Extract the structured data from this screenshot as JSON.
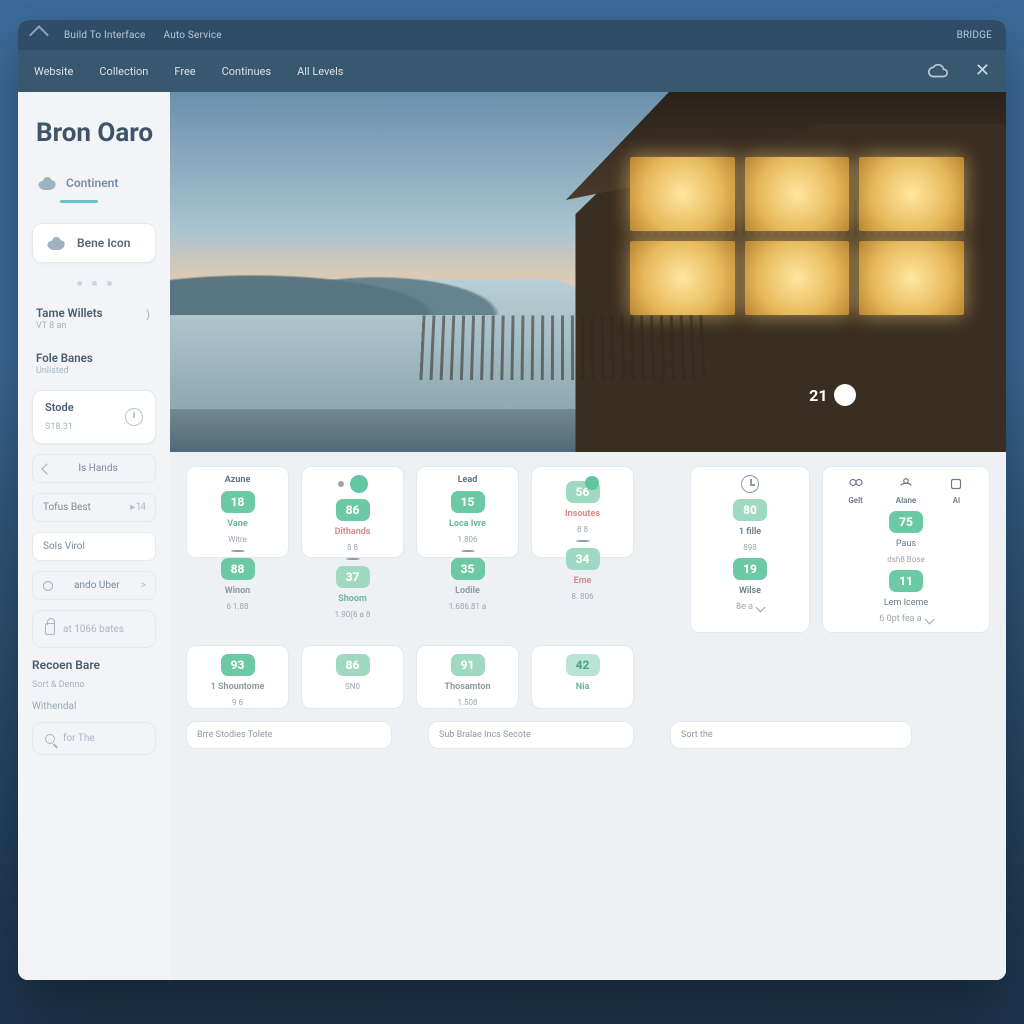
{
  "titlebar": {
    "crumb1": "Build To Interface",
    "crumb2": "Auto Service",
    "right": "BRIDGE"
  },
  "nav": {
    "items": [
      "Website",
      "Collection",
      "Free",
      "Continues",
      "All Levels"
    ]
  },
  "sidebar": {
    "title": "Bron Oaro",
    "tab_label": "Continent",
    "pill_label": "Bene Icon",
    "items": [
      {
        "title": "Tame Willets",
        "sub": "VT 8 an",
        "value": ")"
      },
      {
        "title": "Fole Banes",
        "sub": "Unlisted",
        "value": ""
      }
    ],
    "card": {
      "title": "Stode",
      "sub": "S18.31"
    },
    "rows": [
      {
        "label": "Is Hands",
        "type": "nav"
      },
      {
        "label": "Tofus Best",
        "trail": "▸ 14"
      },
      {
        "label": "Sols Virol",
        "white": true,
        "trail": ""
      },
      {
        "label": "ando Uber",
        "type": "radio",
        "trail": ">"
      }
    ],
    "input1_placeholder": "at 1066 bates",
    "heading": {
      "title": "Recoen Bare",
      "sub": "Sort & Denno"
    },
    "sub_label": "Withendal",
    "search_placeholder": "for The"
  },
  "hero": {
    "badge": "21"
  },
  "dash": {
    "colA": {
      "head": "Azune",
      "b1": "18",
      "l1": "Vane",
      "s1": "Witre",
      "b2": "88",
      "l2": "Winon",
      "s2": "6  1.88",
      "b3": "93",
      "l3": "1 Shountome",
      "s3": "9 6"
    },
    "colB": {
      "b1": "86",
      "l1": "Dithands",
      "s1": "8 8",
      "b2": "37",
      "l2": "Shoom",
      "s2": "1.90(6 a 8",
      "b3": "86",
      "l3": "",
      "s3": "SN0"
    },
    "colC": {
      "head": "Lead",
      "b1": "15",
      "l1": "Loca Ivre",
      "s1": "1.806",
      "b2": "35",
      "l2": "Lodile",
      "s2": "1.686.81 a",
      "b3": "91",
      "l3": "Thosamton",
      "s3": "1.508"
    },
    "colD": {
      "b1": "56",
      "l1": "Insoutes",
      "s1": "8 8",
      "b2": "34",
      "l2": "Eme",
      "s2": "8.  806",
      "b3": "42",
      "l3": "",
      "s3": "Nia"
    },
    "colE": {
      "b1": "80",
      "l1": "1 fille",
      "s1": "898",
      "b2": "19",
      "l2": "Wilse",
      "s2": "8e a"
    },
    "colF": {
      "icons": [
        {
          "name": "Gelt"
        },
        {
          "name": "Alane"
        },
        {
          "name": "Al"
        }
      ],
      "b1": "75",
      "l1": "Paus",
      "s1": "dsh8 Bose",
      "b2": "11",
      "l2": "Lem Iceme",
      "s2": "6 0pt fea a"
    },
    "footers": [
      "Brre  Stodies Tolete",
      "Sub   Bralae Incs Secote",
      "Sort the"
    ]
  }
}
